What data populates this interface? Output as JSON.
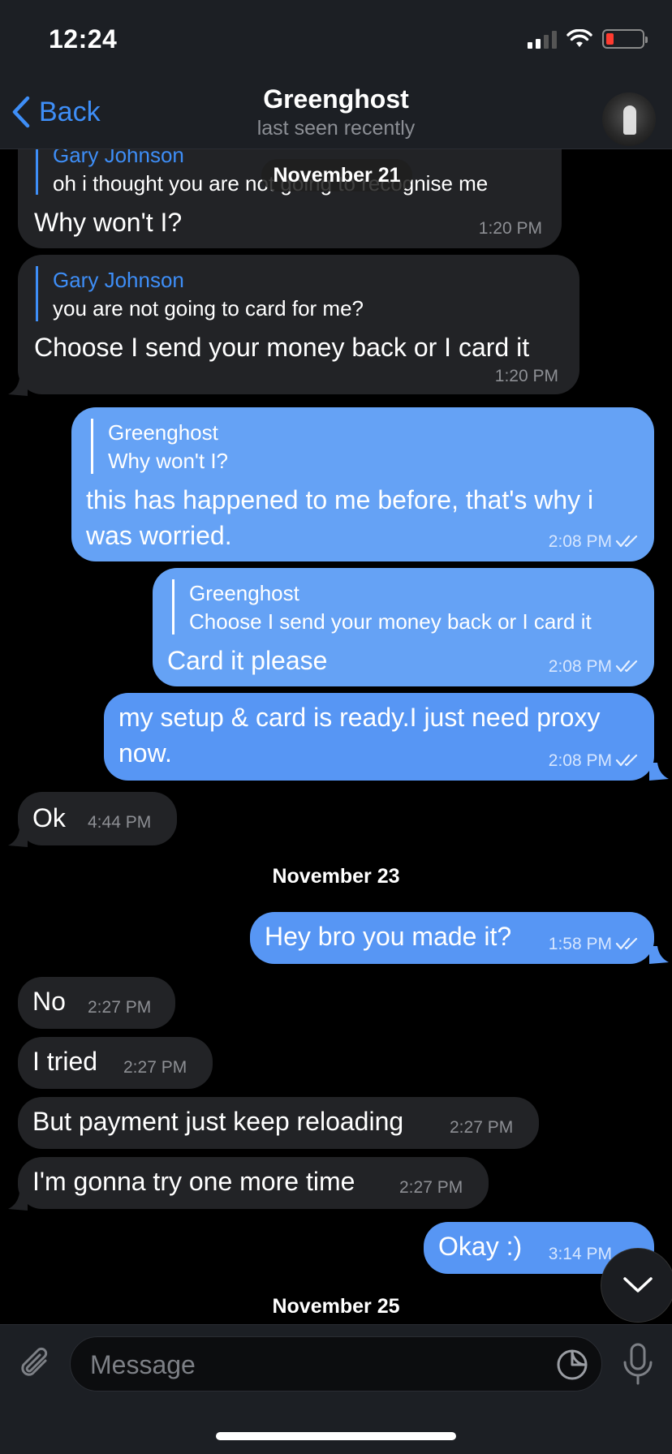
{
  "status_bar": {
    "time": "12:24"
  },
  "header": {
    "back_label": "Back",
    "title": "Greenghost",
    "subtitle": "last seen recently"
  },
  "date_pill": "November 21",
  "messages": [
    {
      "reply_name": "Gary Johnson",
      "reply_text": "oh i thought you are not going to recognise me",
      "text": "Why won't I?",
      "time": "1:20 PM"
    },
    {
      "reply_name": "Gary Johnson",
      "reply_text": "you are not going to card for me?",
      "text": "Choose I send your money back or I card it",
      "time": "1:20 PM"
    },
    {
      "reply_name": "Greenghost",
      "reply_text": "Why won't I?",
      "text_line1": "this has happened to me before, that's why i",
      "text_line2": "was worried.",
      "time": "2:08 PM"
    },
    {
      "reply_name": "Greenghost",
      "reply_text": "Choose I send your money back or I card it",
      "text": "Card it please",
      "time": "2:08 PM"
    },
    {
      "text_line1": "my setup & card is ready.I just need proxy",
      "text_line2": "now.",
      "time": "2:08 PM"
    },
    {
      "text": "Ok",
      "time": "4:44 PM"
    },
    {
      "text": "Hey bro you made it?",
      "time": "1:58 PM"
    },
    {
      "text": "No",
      "time": "2:27 PM"
    },
    {
      "text": "I tried",
      "time": "2:27 PM"
    },
    {
      "text": "But payment just keep reloading",
      "time": "2:27 PM"
    },
    {
      "text": "I'm gonna try one more time",
      "time": "2:27 PM"
    },
    {
      "text": "Okay :)",
      "time": "3:14 PM"
    }
  ],
  "date_separators": [
    "November 23",
    "November 25"
  ],
  "composer": {
    "placeholder": "Message"
  },
  "colors": {
    "accent": "#3e8ef7",
    "outgoing_bubble": "#5796f4",
    "incoming_bubble": "#222326",
    "header_bg": "#1c1f24"
  }
}
